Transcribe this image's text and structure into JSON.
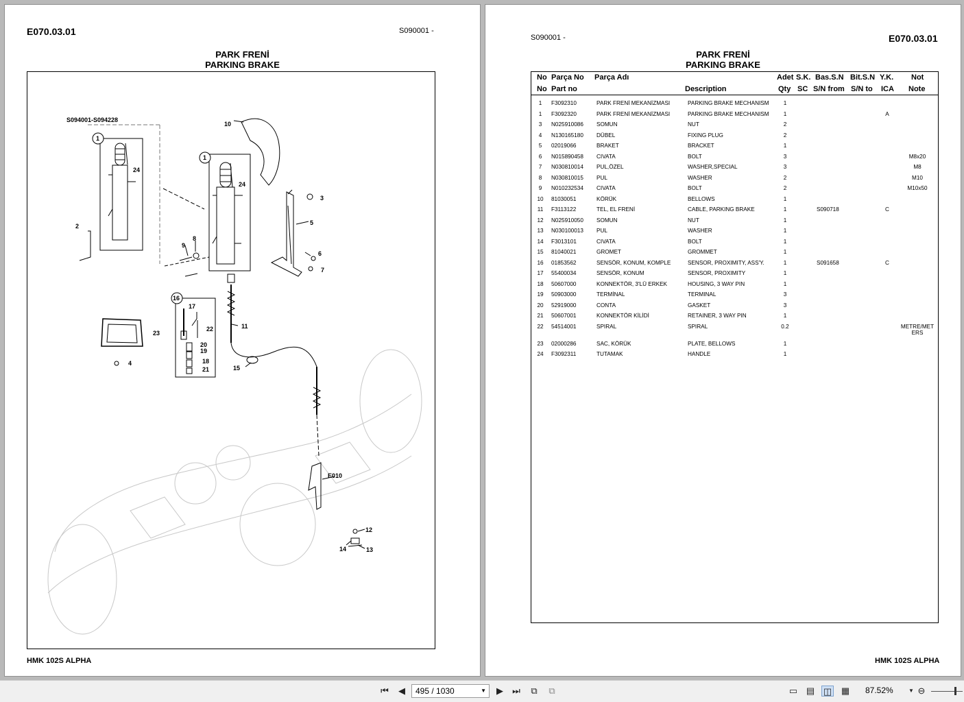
{
  "left_page": {
    "code": "E070.03.01",
    "serial": "S090001 -",
    "title_tr": "PARK FRENİ",
    "title_en": "PARKING BRAKE",
    "footer": "HMK 102S ALPHA",
    "diagram": {
      "serial_label": "S094001-S094228",
      "callouts": [
        "1",
        "24",
        "2",
        "10",
        "1",
        "24",
        "3",
        "5",
        "9",
        "8",
        "6",
        "7",
        "16",
        "17",
        "22",
        "23",
        "20",
        "19",
        "18",
        "21",
        "11",
        "4",
        "15",
        "E010",
        "12",
        "14",
        "13"
      ]
    }
  },
  "right_page": {
    "code": "E070.03.01",
    "serial": "S090001 -",
    "title_tr": "PARK FRENİ",
    "title_en": "PARKING BRAKE",
    "footer": "HMK 102S ALPHA",
    "header_tr": [
      "No",
      "Parça No",
      "Parça Adı",
      "Adet",
      "S.K.",
      "Bas.S.N",
      "Bit.S.N",
      "Y.K.",
      "Not"
    ],
    "header_en": [
      "No",
      "Part no",
      "Description",
      "Qty",
      "SC",
      "S/N from",
      "S/N to",
      "ICA",
      "Note"
    ],
    "rows": [
      {
        "no": "1",
        "part": "F3092310",
        "tr": "PARK FRENİ MEKANİZMASI",
        "en": "PARKING BRAKE MECHANISM",
        "qty": "1",
        "sn_from": "",
        "ica": "",
        "note": ""
      },
      {
        "no": "1",
        "part": "F3092320",
        "tr": "PARK FRENİ MEKANİZMASI",
        "en": "PARKING BRAKE MECHANISM",
        "qty": "1",
        "sn_from": "",
        "ica": "A",
        "note": ""
      },
      {
        "no": "3",
        "part": "N025910086",
        "tr": "SOMUN",
        "en": "NUT",
        "qty": "2",
        "sn_from": "",
        "ica": "",
        "note": ""
      },
      {
        "no": "4",
        "part": "N130165180",
        "tr": "DÜBEL",
        "en": "FIXING PLUG",
        "qty": "2",
        "sn_from": "",
        "ica": "",
        "note": ""
      },
      {
        "no": "5",
        "part": "02019066",
        "tr": "BRAKET",
        "en": "BRACKET",
        "qty": "1",
        "sn_from": "",
        "ica": "",
        "note": ""
      },
      {
        "no": "6",
        "part": "N015890458",
        "tr": "CIVATA",
        "en": "BOLT",
        "qty": "3",
        "sn_from": "",
        "ica": "",
        "note": "M8x20"
      },
      {
        "no": "7",
        "part": "N030810014",
        "tr": "PUL,ÖZEL",
        "en": "WASHER,SPECIAL",
        "qty": "3",
        "sn_from": "",
        "ica": "",
        "note": "M8"
      },
      {
        "no": "8",
        "part": "N030810015",
        "tr": "PUL",
        "en": "WASHER",
        "qty": "2",
        "sn_from": "",
        "ica": "",
        "note": "M10"
      },
      {
        "no": "9",
        "part": "N010232534",
        "tr": "CIVATA",
        "en": "BOLT",
        "qty": "2",
        "sn_from": "",
        "ica": "",
        "note": "M10x50"
      },
      {
        "no": "10",
        "part": "81030051",
        "tr": "KÖRÜK",
        "en": "BELLOWS",
        "qty": "1",
        "sn_from": "",
        "ica": "",
        "note": ""
      },
      {
        "no": "11",
        "part": "F3113122",
        "tr": "TEL, EL FRENİ",
        "en": "CABLE,  PARKING BRAKE",
        "qty": "1",
        "sn_from": "S090718",
        "ica": "C",
        "note": ""
      },
      {
        "no": "12",
        "part": "N025910050",
        "tr": "SOMUN",
        "en": "NUT",
        "qty": "1",
        "sn_from": "",
        "ica": "",
        "note": ""
      },
      {
        "no": "13",
        "part": "N030100013",
        "tr": "PUL",
        "en": "WASHER",
        "qty": "1",
        "sn_from": "",
        "ica": "",
        "note": ""
      },
      {
        "no": "14",
        "part": "F3013101",
        "tr": "CIVATA",
        "en": "BOLT",
        "qty": "1",
        "sn_from": "",
        "ica": "",
        "note": ""
      },
      {
        "no": "15",
        "part": "81040021",
        "tr": "GROMET",
        "en": "GROMMET",
        "qty": "1",
        "sn_from": "",
        "ica": "",
        "note": ""
      },
      {
        "no": "16",
        "part": "01853562",
        "tr": "SENSÖR, KONUM, KOMPLE",
        "en": "SENSOR, PROXIMITY, ASS'Y.",
        "qty": "1",
        "sn_from": "S091658",
        "ica": "C",
        "note": ""
      },
      {
        "no": "17",
        "part": "55400034",
        "tr": "SENSÖR, KONUM",
        "en": "SENSOR, PROXIMITY",
        "qty": "1",
        "sn_from": "",
        "ica": "",
        "note": ""
      },
      {
        "no": "18",
        "part": "50607000",
        "tr": "KONNEKTÖR, 3'LÜ ERKEK",
        "en": "HOUSING, 3 WAY PIN",
        "qty": "1",
        "sn_from": "",
        "ica": "",
        "note": ""
      },
      {
        "no": "19",
        "part": "50903000",
        "tr": "TERMİNAL",
        "en": "TERMINAL",
        "qty": "3",
        "sn_from": "",
        "ica": "",
        "note": ""
      },
      {
        "no": "20",
        "part": "52919000",
        "tr": "CONTA",
        "en": "GASKET",
        "qty": "3",
        "sn_from": "",
        "ica": "",
        "note": ""
      },
      {
        "no": "21",
        "part": "50607001",
        "tr": "KONNEKTÖR KİLİDİ",
        "en": "RETAINER, 3 WAY PIN",
        "qty": "1",
        "sn_from": "",
        "ica": "",
        "note": ""
      },
      {
        "no": "22",
        "part": "54514001",
        "tr": "SPIRAL",
        "en": "SPIRAL",
        "qty": "0.2",
        "sn_from": "",
        "ica": "",
        "note": "METRE/MET ERS"
      },
      {
        "no": "23",
        "part": "02000286",
        "tr": "SAC, KÖRÜK",
        "en": "PLATE, BELLOWS",
        "qty": "1",
        "sn_from": "",
        "ica": "",
        "note": ""
      },
      {
        "no": "24",
        "part": "F3092311",
        "tr": "TUTAMAK",
        "en": "HANDLE",
        "qty": "1",
        "sn_from": "",
        "ica": "",
        "note": ""
      }
    ]
  },
  "toolbar": {
    "page_display": "495 / 1030",
    "zoom": "87.52%",
    "icons": [
      "first-page-icon",
      "prev-page-icon",
      "next-page-icon",
      "last-page-icon",
      "go-back-icon",
      "go-forward-icon",
      "single-page-icon",
      "continuous-icon",
      "two-page-icon",
      "two-page-continuous-icon",
      "zoom-dropdown-icon",
      "zoom-out-icon"
    ]
  }
}
